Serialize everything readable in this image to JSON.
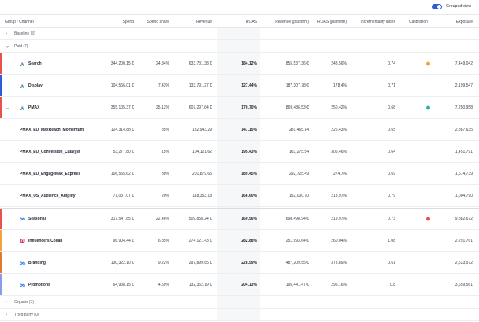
{
  "grouped_view": {
    "label": "Grouped view",
    "enabled": true
  },
  "columns": [
    "Group / Channel",
    "Spend",
    "Spend share",
    "Revenue",
    "ROAS",
    "Revenue (platform)",
    "ROAS (platform)",
    "Incrementality index",
    "Calibration",
    "Exposure"
  ],
  "groups": {
    "baseline": "Baseline (5)",
    "paid": "Paid (7)",
    "organic": "Organic (7)",
    "third_party": "Third party (0)"
  },
  "rows": {
    "search": {
      "name": "Search",
      "spend": "344,200.15 €",
      "share": "24.34%",
      "revenue": "633,731.38 €",
      "roas": "184.12%",
      "rev_platform": "855,537.36 €",
      "roas_platform": "248.56%",
      "index": "0.74",
      "exposure": "7,449,042",
      "color": "#e5534b",
      "calibration": "#f2a33a",
      "icon": "google-ads-icon"
    },
    "display": {
      "name": "Display",
      "spend": "104,566.01 €",
      "share": "7.43%",
      "revenue": "133,791.27 €",
      "roas": "127.44%",
      "rev_platform": "187,307.78 €",
      "roas_platform": "178.4%",
      "index": "0.71",
      "exposure": "2,199,547",
      "color": "#2f5bd8",
      "calibration": "",
      "icon": "google-ads-icon"
    },
    "pmax": {
      "name": "PMAX",
      "spend": "355,105.37 €",
      "share": "25.12%",
      "revenue": "607,297.64 €",
      "roas": "170.70%",
      "rev_platform": "869,486.53 €",
      "roas_platform": "250.42%",
      "index": "0.68",
      "exposure": "7,250,958",
      "color": "#e5534b",
      "calibration": "#2bb3a0",
      "icon": "google-ads-icon"
    },
    "pmax_1": {
      "name": "PMAX_EU_MaxReach_Momentum",
      "spend": "124,314.88 €",
      "share": "35%",
      "revenue": "182,943.29",
      "roas": "147.15%",
      "rev_platform": "281,465.14",
      "roas_platform": "226.43%",
      "index": "0.65",
      "exposure": "2,887,635"
    },
    "pmax_2": {
      "name": "PMAX_EU_Conversion_Catalyst",
      "spend": "53,277.80 €",
      "share": "15%",
      "revenue": "104,121.62",
      "roas": "195.43%",
      "rev_platform": "163,275.54",
      "roas_platform": "306.46%",
      "index": "0.64",
      "exposure": "1,451,791"
    },
    "pmax_3": {
      "name": "PMAX_EU_EngageMax_Express",
      "spend": "106,555.62 €",
      "share": "30%",
      "revenue": "201,879.65",
      "roas": "189.45%",
      "rev_platform": "292,725.49",
      "roas_platform": "274.7%",
      "index": "0.69",
      "exposure": "1,614,739"
    },
    "pmax_4": {
      "name": "PMAX_US_Audience_Amplify",
      "spend": "71,037.07 €",
      "share": "20%",
      "revenue": "118,353.18",
      "roas": "166.60%",
      "rev_platform": "152,000.70",
      "roas_platform": "213.97%",
      "index": "0.79",
      "exposure": "1,004,790"
    },
    "seasonal": {
      "name": "Seasonal",
      "spend": "317,547.85 €",
      "share": "22.46%",
      "revenue": "509,858.24 €",
      "roas": "160.56%",
      "rev_platform": "698,498.94 €",
      "roas_platform": "219.97%",
      "index": "0.73",
      "exposure": "9,882,672",
      "color": "#e5534b",
      "calibration": "#e5534b",
      "icon": "meta-icon"
    },
    "influencers": {
      "name": "Influencers Collab",
      "spend": "96,904.44 €",
      "share": "6.85%",
      "revenue": "274,121.43 €",
      "roas": "282.88%",
      "rev_platform": "251,993.64 €",
      "roas_platform": "260.04%",
      "index": "1.08",
      "exposure": "2,291,761",
      "color": "#f2a33a",
      "calibration": "",
      "icon": "instagram-icon"
    },
    "branding": {
      "name": "Branding",
      "spend": "130,322.10 €",
      "share": "9.22%",
      "revenue": "297,899.65 €",
      "roas": "228.59%",
      "rev_platform": "487,209.55 €",
      "roas_platform": "373.89%",
      "index": "0.61",
      "exposure": "2,633,572",
      "color": "#e07a2f",
      "calibration": "",
      "icon": "meta-icon"
    },
    "promotions": {
      "name": "Promotions",
      "spend": "64,938.15 €",
      "share": "4.59%",
      "revenue": "132,352.19 €",
      "roas": "204.13%",
      "rev_platform": "195,441.47 €",
      "roas_platform": "295.16%",
      "index": "0.8",
      "exposure": "3,659,561",
      "color": "#8a9be8",
      "calibration": "",
      "icon": "meta-icon"
    }
  }
}
